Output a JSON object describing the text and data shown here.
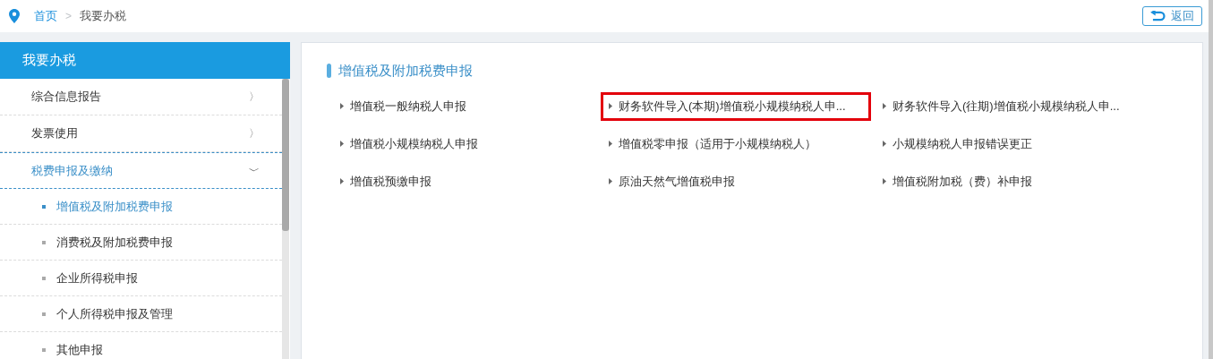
{
  "breadcrumb": {
    "items": [
      "首页",
      "我要办税"
    ],
    "separator": ">"
  },
  "back_button": {
    "label": "返回"
  },
  "sidebar": {
    "title": "我要办税",
    "items": [
      {
        "label": "综合信息报告",
        "expanded": false,
        "arrow": "〉"
      },
      {
        "label": "发票使用",
        "expanded": false,
        "arrow": "〉"
      },
      {
        "label": "税费申报及缴纳",
        "expanded": true,
        "arrow": "﹀",
        "children": [
          {
            "label": "增值税及附加税费申报",
            "selected": true
          },
          {
            "label": "消费税及附加税费申报",
            "selected": false
          },
          {
            "label": "企业所得税申报",
            "selected": false
          },
          {
            "label": "个人所得税申报及管理",
            "selected": false
          },
          {
            "label": "其他申报",
            "selected": false
          }
        ]
      }
    ]
  },
  "section": {
    "title": "增值税及附加税费申报",
    "links": [
      {
        "label": "增值税一般纳税人申报",
        "highlighted": false
      },
      {
        "label": "财务软件导入(本期)增值税小规模纳税人申...",
        "highlighted": true
      },
      {
        "label": "财务软件导入(往期)增值税小规模纳税人申...",
        "highlighted": false
      },
      {
        "label": "增值税小规模纳税人申报",
        "highlighted": false
      },
      {
        "label": "增值税零申报（适用于小规模纳税人）",
        "highlighted": false
      },
      {
        "label": "小规模纳税人申报错误更正",
        "highlighted": false
      },
      {
        "label": "增值税预缴申报",
        "highlighted": false
      },
      {
        "label": "原油天然气增值税申报",
        "highlighted": false
      },
      {
        "label": "增值税附加税（费）补申报",
        "highlighted": false
      }
    ]
  }
}
